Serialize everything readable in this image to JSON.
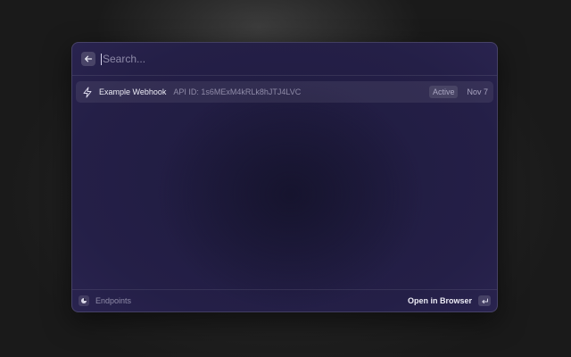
{
  "search": {
    "placeholder": "Search...",
    "back_icon": "arrow-left-icon"
  },
  "results": [
    {
      "icon": "lightning-bolt-icon",
      "title": "Example Webhook",
      "subtitle": "API ID: 1s6MExM4kRLk8hJTJ4LVC",
      "status": "Active",
      "date": "Nov 7"
    }
  ],
  "footer": {
    "logo_icon": "app-logo-icon",
    "label": "Endpoints",
    "action_label": "Open in Browser",
    "action_key_icon": "return-key-icon"
  }
}
